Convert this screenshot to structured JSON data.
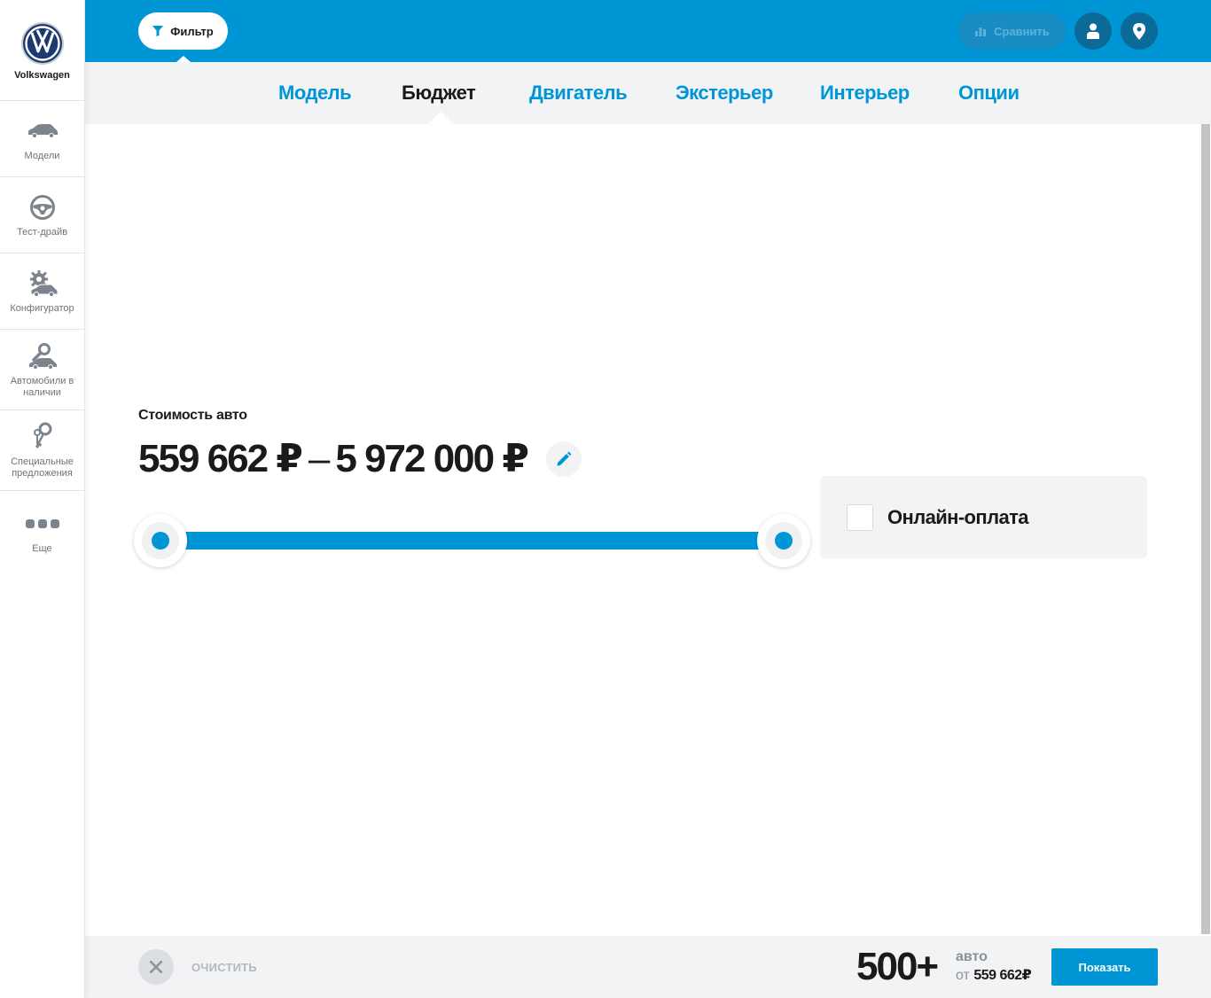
{
  "brand": {
    "name": "Volkswagen",
    "logo": "vw-logo"
  },
  "sidebar": {
    "items": [
      {
        "label": "Модели",
        "icon": "car-icon"
      },
      {
        "label": "Тест-драйв",
        "icon": "steering-wheel-icon"
      },
      {
        "label": "Конфигуратор",
        "icon": "configurator-gear-car-icon"
      },
      {
        "label": "Автомобили в наличии",
        "icon": "car-search-icon"
      },
      {
        "label": "Специальные предложения",
        "icon": "keys-icon"
      },
      {
        "label": "Еще",
        "icon": "more-dots-icon"
      }
    ]
  },
  "topbar": {
    "filter_label": "Фильтр",
    "compare_label": "Сравнить"
  },
  "tabs": [
    {
      "label": "Модель",
      "active": false
    },
    {
      "label": "Бюджет",
      "active": true
    },
    {
      "label": "Двигатель",
      "active": false
    },
    {
      "label": "Экстерьер",
      "active": false
    },
    {
      "label": "Интерьер",
      "active": false
    },
    {
      "label": "Опции",
      "active": false
    }
  ],
  "budget": {
    "title": "Стоимость авто",
    "min_price": "559 662 ₽",
    "separator": "–",
    "max_price": "5 972 000 ₽",
    "slider_min_fraction": 0,
    "slider_max_fraction": 1
  },
  "online_payment": {
    "label": "Онлайн-оплата",
    "checked": false
  },
  "bottombar": {
    "clear_label": "ОЧИСТИТЬ",
    "count": "500+",
    "count_unit": "авто",
    "from_prefix": "от",
    "from_price": "559 662₽",
    "show_label": "Показать"
  },
  "colors": {
    "accent": "#0096d6",
    "panel": "#f2f3f5",
    "dark_button": "#0b6a98"
  }
}
